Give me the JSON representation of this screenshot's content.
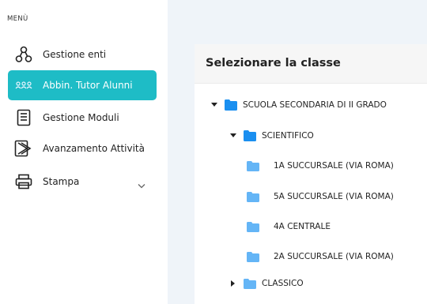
{
  "sidebar": {
    "caption": "MENÙ",
    "items": [
      {
        "label": "Gestione enti"
      },
      {
        "label": "Abbin. Tutor Alunni"
      },
      {
        "label": "Gestione Moduli"
      },
      {
        "label": "Avanzamento Attività"
      },
      {
        "label": "Stampa"
      }
    ]
  },
  "panel": {
    "title": "Selezionare la classe",
    "tree": {
      "root": "SCUOLA SECONDARIA DI II GRADO",
      "scientifico": "SCIENTIFICO",
      "classes": [
        "1A SUCCURSALE (VIA ROMA)",
        "5A SUCCURSALE (VIA ROMA)",
        "4A CENTRALE",
        "2A SUCCURSALE (VIA ROMA)"
      ],
      "classico": "CLASSICO"
    }
  },
  "colors": {
    "active_item": "#1ebcc6",
    "folder_dark": "#1a8ff0",
    "folder_light": "#64b5f6",
    "content_bg": "#eff4f9"
  }
}
